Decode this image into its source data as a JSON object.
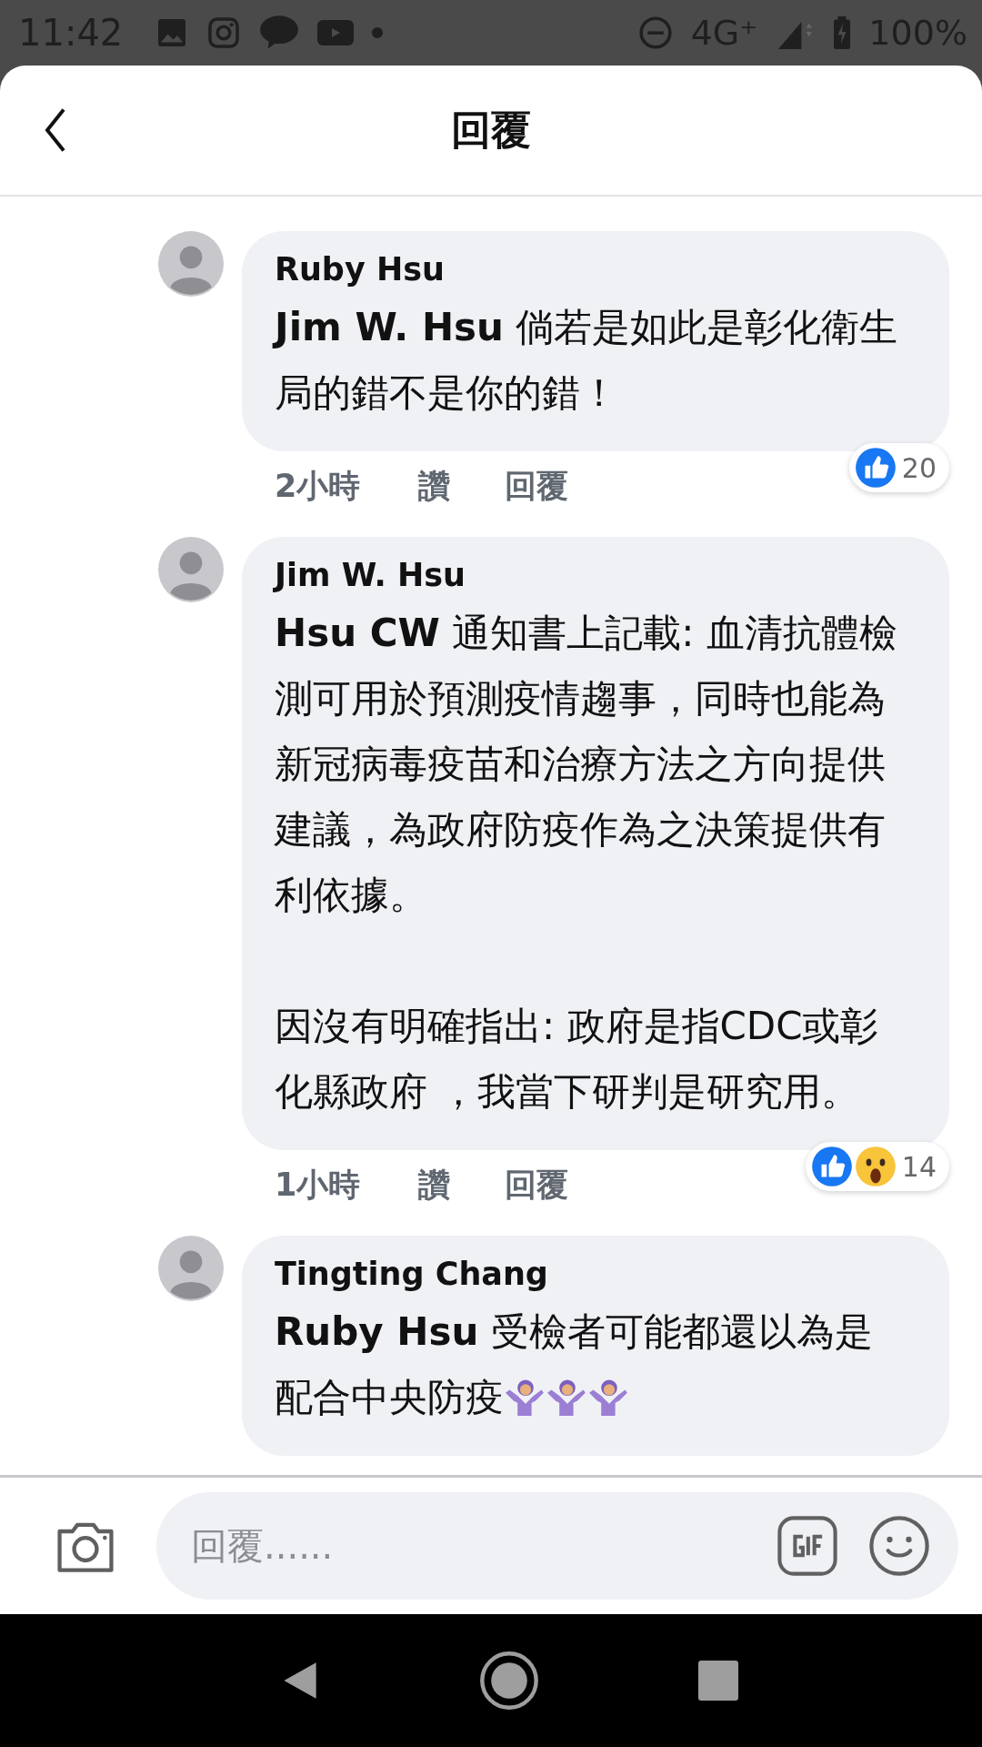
{
  "status_bar": {
    "time": "11:42",
    "network": "4G⁺",
    "battery": "100%"
  },
  "header": {
    "title": "回覆"
  },
  "comments": [
    {
      "author": "Ruby Hsu",
      "paragraphs": [
        "**Jim W. Hsu** 倘若是如此是彰化衛生局的錯不是你的錯！"
      ],
      "time": "2小時",
      "like": "讚",
      "reply": "回覆",
      "reactions": [
        {
          "kind": "like"
        }
      ],
      "reaction_count": "20"
    },
    {
      "author": "Jim W. Hsu",
      "paragraphs": [
        "**Hsu CW** 通知書上記載: 血清抗體檢測可用於預測疫情趨事，同時也能為新冠病毒疫苗和治療方法之方向提供建議，為政府防疫作為之決策提供有利依據。",
        "因沒有明確指出: 政府是指CDC或彰化縣政府 ，我當下研判是研究用。"
      ],
      "time": "1小時",
      "like": "讚",
      "reply": "回覆",
      "reactions": [
        {
          "kind": "like"
        },
        {
          "kind": "wow"
        }
      ],
      "reaction_count": "14"
    },
    {
      "author": "Tingting Chang",
      "paragraphs": [
        "**Ruby Hsu** 受檢者可能都還以為是",
        "配合中央防疫"
      ],
      "emojis": [
        {
          "kind": "shrug"
        },
        {
          "kind": "shrug"
        },
        {
          "kind": "shrug"
        }
      ]
    }
  ],
  "composer": {
    "placeholder": "回覆......"
  }
}
